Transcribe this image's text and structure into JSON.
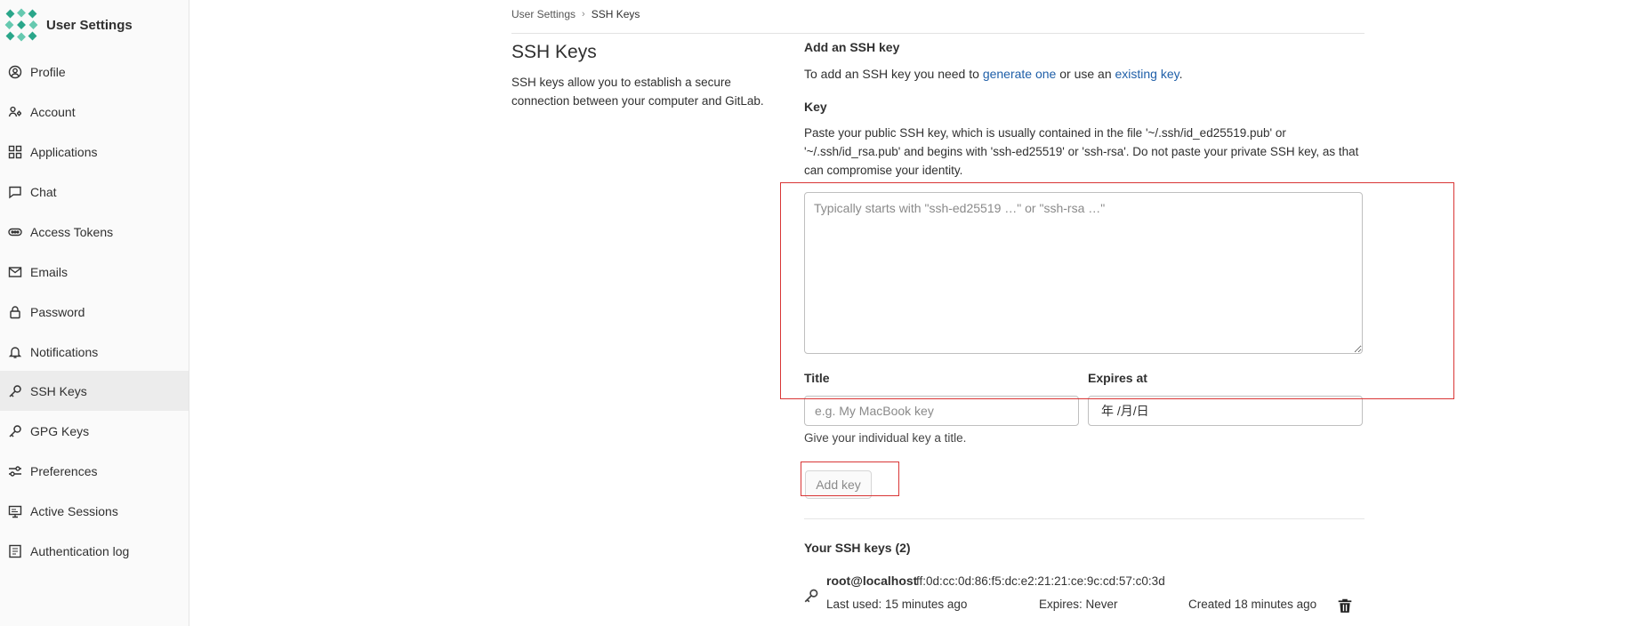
{
  "sidebar": {
    "title": "User Settings",
    "items": [
      {
        "label": "Profile",
        "icon": "profile-icon"
      },
      {
        "label": "Account",
        "icon": "account-icon"
      },
      {
        "label": "Applications",
        "icon": "applications-icon"
      },
      {
        "label": "Chat",
        "icon": "chat-icon"
      },
      {
        "label": "Access Tokens",
        "icon": "token-icon"
      },
      {
        "label": "Emails",
        "icon": "mail-icon"
      },
      {
        "label": "Password",
        "icon": "lock-icon"
      },
      {
        "label": "Notifications",
        "icon": "bell-icon"
      },
      {
        "label": "SSH Keys",
        "icon": "key-icon",
        "active": true
      },
      {
        "label": "GPG Keys",
        "icon": "key-icon"
      },
      {
        "label": "Preferences",
        "icon": "preferences-icon"
      },
      {
        "label": "Active Sessions",
        "icon": "monitor-icon"
      },
      {
        "label": "Authentication log",
        "icon": "log-icon"
      }
    ]
  },
  "breadcrumb": {
    "parent": "User Settings",
    "sep": "›",
    "current": "SSH Keys"
  },
  "page": {
    "title": "SSH Keys",
    "description": "SSH keys allow you to establish a secure connection between your computer and GitLab."
  },
  "form": {
    "section_title": "Add an SSH key",
    "intro_prefix": "To add an SSH key you need to ",
    "intro_link1": "generate one",
    "intro_mid": " or use an ",
    "intro_link2": "existing key",
    "intro_suffix": ".",
    "key_label": "Key",
    "key_help": "Paste your public SSH key, which is usually contained in the file '~/.ssh/id_ed25519.pub' or '~/.ssh/id_rsa.pub' and begins with 'ssh-ed25519' or 'ssh-rsa'. Do not paste your private SSH key, as that can compromise your identity.",
    "key_placeholder": "Typically starts with \"ssh-ed25519 …\" or \"ssh-rsa …\"",
    "title_label": "Title",
    "title_placeholder": "e.g. My MacBook key",
    "expires_label": "Expires at",
    "expires_value": "年 /月/日",
    "title_hint": "Give your individual key a title.",
    "submit_label": "Add key"
  },
  "keys": {
    "heading": "Your SSH keys (2)",
    "items": [
      {
        "name": "root@localhost",
        "fingerprint": "ff:0d:cc:0d:86:f5:dc:e2:21:21:ce:9c:cd:57:c0:3d",
        "last_used": "Last used: 15 minutes ago",
        "expires": "Expires: Never",
        "created": "Created 18 minutes ago"
      }
    ]
  },
  "colors": {
    "link": "#1f5fa8",
    "annotation": "#d93636",
    "active_bg": "#ececec"
  }
}
